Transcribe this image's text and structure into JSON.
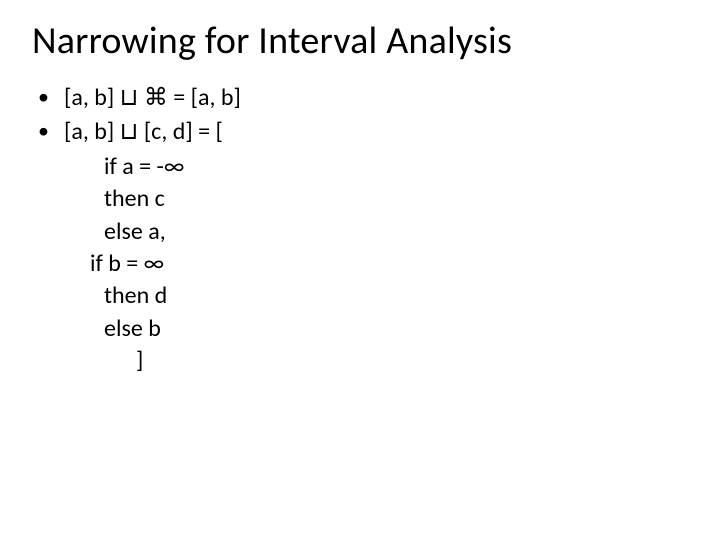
{
  "title": "Narrowing for Interval Analysis",
  "bullet1": "[a, b] ⊔ ⌘ = [a, b]",
  "bullet2": "[a, b] ⊔ [c, d] = [",
  "line_if_a": "if a = -∞",
  "line_then_c": "then c",
  "line_else_a": "else a,",
  "line_if_b": "if b = ∞",
  "line_then_d": "then d",
  "line_else_b": "else b",
  "line_close": "]"
}
